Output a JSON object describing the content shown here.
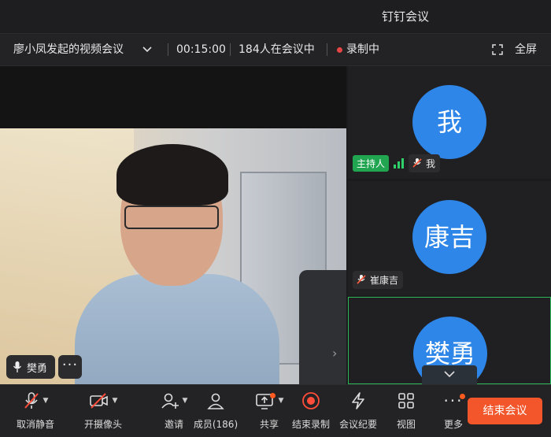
{
  "app": {
    "title": "钉钉会议"
  },
  "meeting": {
    "name": "廖小凤发起的视频会议",
    "timer": "00:15:00",
    "participants_text": "184人在会议中",
    "recording_text": "录制中",
    "fullscreen_label": "全屏"
  },
  "main_video": {
    "speaker_name": "樊勇"
  },
  "tiles": [
    {
      "avatar_text": "我",
      "host_badge": "主持人",
      "name": "我"
    },
    {
      "avatar_text": "康吉",
      "name": "崔康吉"
    },
    {
      "avatar_text": "樊勇"
    }
  ],
  "toolbar": {
    "mute": "取消静音",
    "camera": "开摄像头",
    "invite": "邀请",
    "members": "成员(186)",
    "share": "共享",
    "stop_record": "结束录制",
    "minutes": "会议纪要",
    "view": "视图",
    "more": "更多",
    "end": "结束会议"
  },
  "colors": {
    "accent_green": "#21a550",
    "avatar_blue": "#2e86e8",
    "end_orange": "#f2562a",
    "rec_red": "#e64545"
  }
}
